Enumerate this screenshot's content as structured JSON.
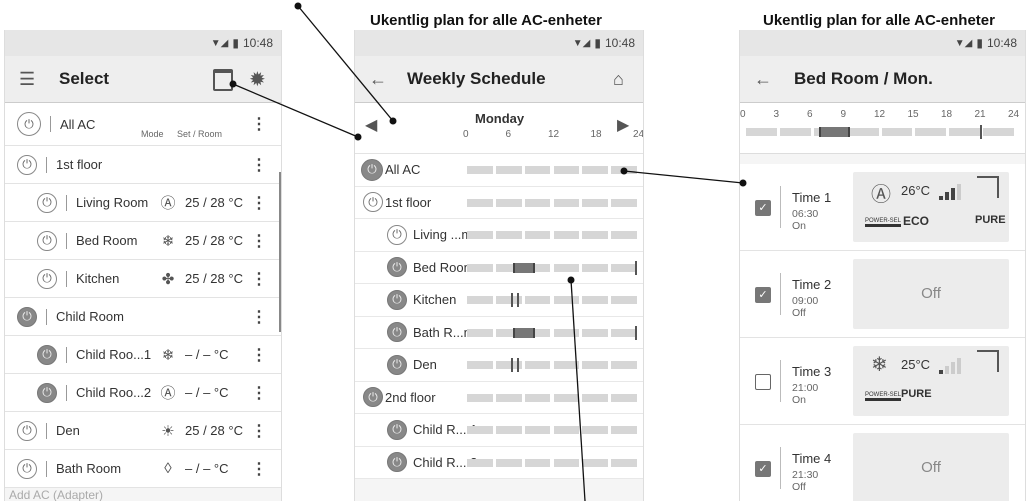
{
  "captions": {
    "middle": "Ukentlig plan for alle AC-enheter",
    "right": "Ukentlig plan for alle AC-enheter"
  },
  "status": {
    "time": "10:48"
  },
  "screen1": {
    "title": "Select",
    "icons": {
      "menu": "list-icon",
      "schedule": "calendar-schedule-icon",
      "settings": "gear-icon"
    },
    "header_row": {
      "name": "All AC",
      "col_mode": "Mode",
      "col_set_room": "Set / Room"
    },
    "rows": [
      {
        "name": "1st floor",
        "level": 0,
        "power": "off",
        "mode": "",
        "temp": ""
      },
      {
        "name": "Living Room",
        "level": 1,
        "power": "off",
        "mode": "Ⓐ",
        "mode_icon": "auto-mode-icon",
        "temp": "25 / 28 °C"
      },
      {
        "name": "Bed Room",
        "level": 1,
        "power": "off",
        "mode": "❄",
        "mode_icon": "cool-mode-icon",
        "temp": "25 / 28 °C"
      },
      {
        "name": "Kitchen",
        "level": 1,
        "power": "off",
        "mode": "✤",
        "mode_icon": "fan-mode-icon",
        "temp": "25 / 28 °C"
      },
      {
        "name": "Child Room",
        "level": 0,
        "power": "on",
        "mode": "",
        "temp": ""
      },
      {
        "name": "Child Roo...1",
        "level": 1,
        "power": "on",
        "mode": "❄",
        "mode_icon": "cool-mode-icon",
        "temp": "– / –  °C"
      },
      {
        "name": "Child Roo...2",
        "level": 1,
        "power": "on",
        "mode": "Ⓐ",
        "mode_icon": "auto-mode-icon",
        "temp": "– / –  °C"
      },
      {
        "name": "Den",
        "level": 0,
        "power": "off",
        "mode": "☀",
        "mode_icon": "heat-mode-icon",
        "temp": "25 / 28 °C"
      },
      {
        "name": "Bath Room",
        "level": 0,
        "power": "off",
        "mode": "◊",
        "mode_icon": "dry-mode-icon",
        "temp": "– / –  °C"
      }
    ],
    "footer": "Add AC (Adapter)"
  },
  "screen2": {
    "title": "Weekly Schedule",
    "day": "Monday",
    "ticks": [
      "0",
      "6",
      "12",
      "18",
      "24"
    ],
    "rows": [
      {
        "name": "All AC",
        "power": "on-large",
        "indent": 0,
        "marks": []
      },
      {
        "name": "1st floor",
        "power": "off",
        "indent": 0,
        "marks": []
      },
      {
        "name": "Living ...m",
        "power": "off",
        "indent": 1,
        "marks": []
      },
      {
        "name": "Bed Room",
        "power": "on",
        "indent": 1,
        "marks": [
          "block:6.5-9",
          "line:23.9"
        ]
      },
      {
        "name": "Kitchen",
        "power": "on",
        "indent": 1,
        "marks": [
          "line:6.4",
          "line:7.2"
        ]
      },
      {
        "name": "Bath R...m",
        "power": "on",
        "indent": 1,
        "marks": [
          "block:6.5-9",
          "line:23.9"
        ]
      },
      {
        "name": "Den",
        "power": "on",
        "indent": 1,
        "marks": [
          "line:6.4",
          "line:7.2"
        ]
      },
      {
        "name": "2nd floor",
        "power": "on",
        "indent": 0,
        "marks": []
      },
      {
        "name": "Child R... 1",
        "power": "on",
        "indent": 1,
        "marks": []
      },
      {
        "name": "Child R... 2",
        "power": "on",
        "indent": 1,
        "marks": []
      }
    ]
  },
  "screen3": {
    "title": "Bed Room / Mon.",
    "ticks": [
      "0",
      "3",
      "6",
      "9",
      "12",
      "15",
      "18",
      "21",
      "24"
    ],
    "times": [
      {
        "name": "Time 1",
        "time": "06:30",
        "state": "On",
        "checked": true,
        "card": "on",
        "mode": "Ⓐ",
        "mode_icon": "auto-mode-icon",
        "temp": "26°C",
        "fan_level": 3,
        "powersel": "POWER-SEL",
        "eco": "ECO",
        "pure": "PURE"
      },
      {
        "name": "Time 2",
        "time": "09:00",
        "state": "Off",
        "checked": true,
        "card": "off",
        "off_label": "Off"
      },
      {
        "name": "Time 3",
        "time": "21:00",
        "state": "On",
        "checked": false,
        "card": "on",
        "mode": "❄",
        "mode_icon": "cool-mode-icon",
        "temp": "25°C",
        "fan_level": 1,
        "powersel": "POWER-SEL",
        "eco": "",
        "pure": "PURE"
      },
      {
        "name": "Time 4",
        "time": "21:30",
        "state": "Off",
        "checked": true,
        "card": "off",
        "off_label": "Off"
      }
    ]
  }
}
